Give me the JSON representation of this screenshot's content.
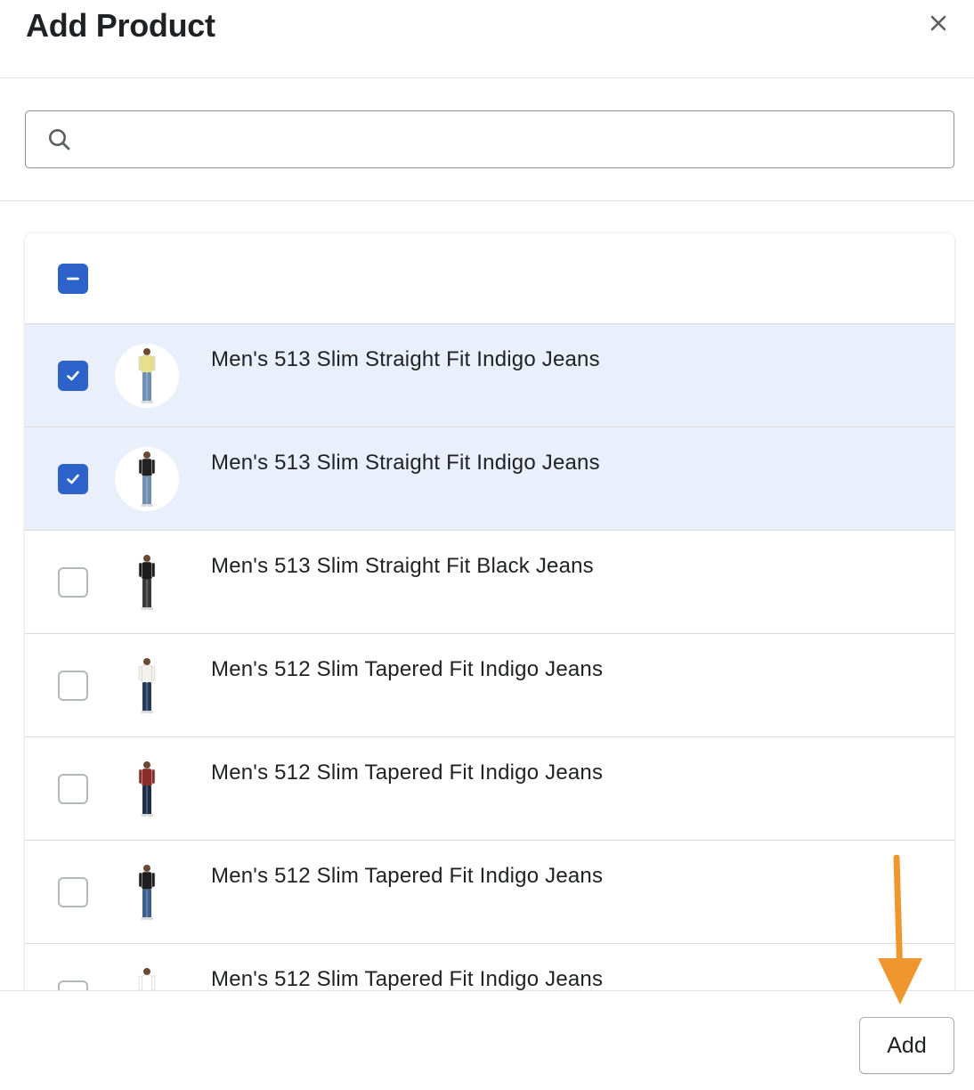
{
  "modal": {
    "title": "Add Product"
  },
  "search": {
    "value": "",
    "placeholder": ""
  },
  "list": {
    "select_all_state": "indeterminate",
    "rows": [
      {
        "label": "Men's 513 Slim Straight Fit Indigo Jeans",
        "checked": true,
        "thumb_shirt": "#e9e08a",
        "thumb_pants": "#6e8fb3"
      },
      {
        "label": "Men's 513 Slim Straight Fit Indigo Jeans",
        "checked": true,
        "thumb_shirt": "#222222",
        "thumb_pants": "#6f8eb0"
      },
      {
        "label": "Men's 513 Slim Straight Fit Black Jeans",
        "checked": false,
        "thumb_shirt": "#1c1c1c",
        "thumb_pants": "#3a3a3a"
      },
      {
        "label": "Men's 512 Slim Tapered Fit Indigo Jeans",
        "checked": false,
        "thumb_shirt": "#f4f2ec",
        "thumb_pants": "#263a5c"
      },
      {
        "label": "Men's 512 Slim Tapered Fit Indigo Jeans",
        "checked": false,
        "thumb_shirt": "#8a2c2c",
        "thumb_pants": "#1f2d4a"
      },
      {
        "label": "Men's 512 Slim Tapered Fit Indigo Jeans",
        "checked": false,
        "thumb_shirt": "#1e1e1e",
        "thumb_pants": "#3c5f8c"
      },
      {
        "label": "Men's 512 Slim Tapered Fit Indigo Jeans",
        "checked": false,
        "thumb_shirt": "#ffffff",
        "thumb_pants": "#4b6a94"
      }
    ]
  },
  "footer": {
    "add_label": "Add"
  },
  "colors": {
    "accent": "#2c62c9",
    "selected_row": "#e9f0fb",
    "annotation_arrow": "#f0962e"
  },
  "icons": {
    "close": "close-icon",
    "search": "search-icon",
    "check": "check-icon",
    "dash": "dash-icon"
  }
}
